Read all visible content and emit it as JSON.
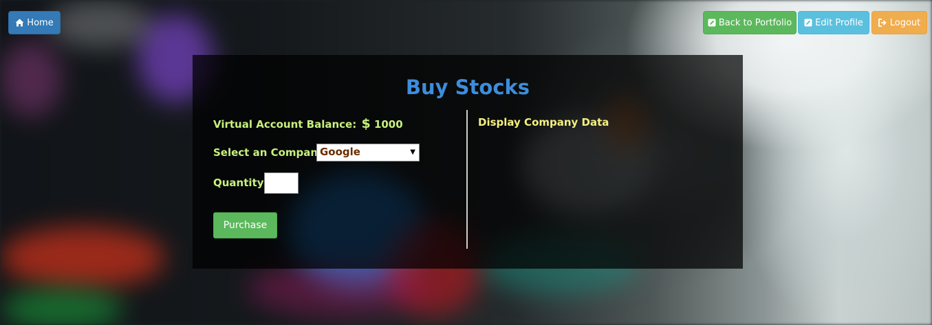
{
  "nav": {
    "home_label": "Home",
    "portfolio_label": "Back to Portfolio",
    "edit_profile_label": "Edit Profile",
    "logout_label": "Logout",
    "icons": {
      "home": "home-icon",
      "portfolio": "edit-square-icon",
      "edit_profile": "edit-square-icon",
      "logout": "logout-icon"
    }
  },
  "page": {
    "title": "Buy Stocks"
  },
  "form": {
    "balance_label": "Virtual Account Balance:",
    "currency_symbol": "$",
    "balance_value": "1000",
    "company_label": "Select an Company:",
    "company_selected": "Google",
    "quantity_label": "Quantity:",
    "quantity_value": "",
    "purchase_label": "Purchase"
  },
  "company_panel": {
    "heading": "Display Company Data"
  },
  "colors": {
    "title": "#3d8ddc",
    "form_labels": "#c6f17e",
    "company_heading": "#f3f081",
    "home_button": "#337ab7",
    "portfolio_button": "#5cb85c",
    "edit_button": "#5bc0de",
    "logout_button": "#f0ad4e",
    "purchase_button": "#5cb85c"
  }
}
